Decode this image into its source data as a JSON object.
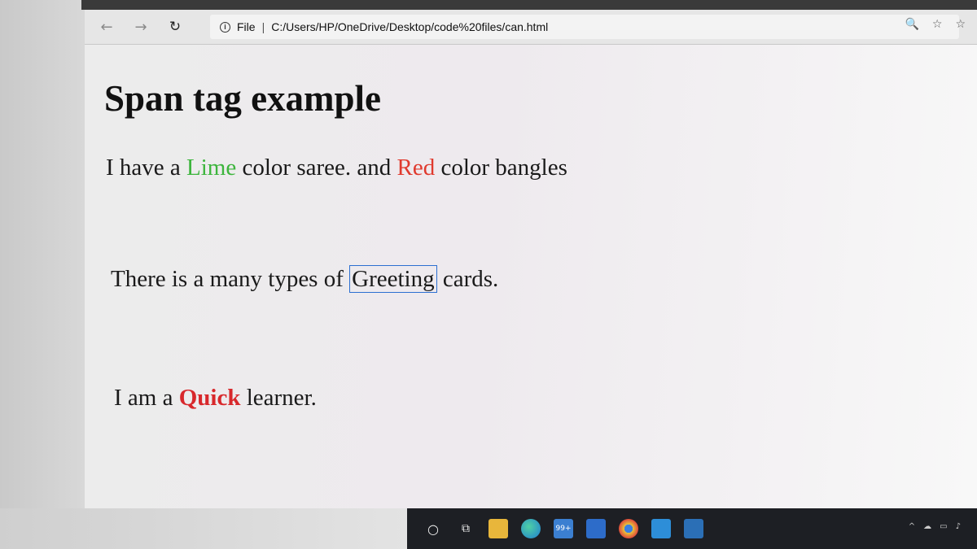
{
  "browser": {
    "back_icon": "←",
    "forward_icon": "→",
    "reload_icon": "↻",
    "info_icon": "i",
    "file_label": "File",
    "separator": "|",
    "url": "C:/Users/HP/OneDrive/Desktop/code%20files/can.html",
    "zoom_icon": "🔍",
    "favorite_icon": "☆",
    "collections_icon": "☆"
  },
  "page": {
    "title": "Span tag example",
    "line1": {
      "pre": "I have a ",
      "lime": "Lime",
      "mid": " color saree. and ",
      "red": "Red",
      "post": " color bangles"
    },
    "line2": {
      "pre": "There is a many types of ",
      "greeting": "Greeting",
      "post": " cards."
    },
    "line3": {
      "pre": "I am a ",
      "quick": "Quick",
      "post": " learner."
    }
  },
  "taskbar": {
    "search_icon": "○",
    "taskview_icon": "⧉",
    "mail_badge": "99+"
  },
  "colors": {
    "lime": "#3db53d",
    "red": "#e03a2e",
    "quick": "#d8282c",
    "greeting_border": "#2c6fd1"
  }
}
